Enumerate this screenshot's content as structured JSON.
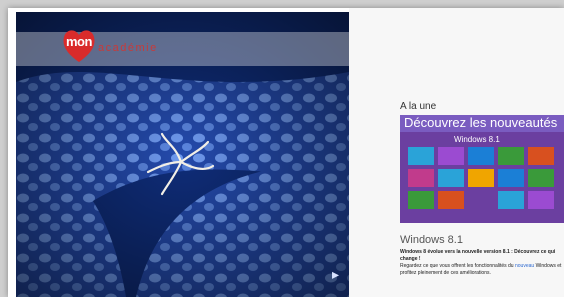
{
  "brand": {
    "name": "mon",
    "suffix": "académie",
    "badge_color": "#d92b2b"
  },
  "hero": {
    "icon": "next-arrow-icon",
    "colors": {
      "background": "#1c3f9e",
      "spots": "#6f9af0",
      "starfish": "#f2efe6"
    }
  },
  "news": {
    "section_title": "A la une",
    "image": {
      "banner_text": "Découvrez les nouveautés",
      "product_label": "Windows 8.1",
      "tile_colors": [
        "#2aa3d8",
        "#9b4bd1",
        "#1b7fd6",
        "#3a9a3a",
        "#d8501f",
        "#c13b8c",
        "#2aa3d8",
        "#f0a500",
        "#1b7fd6",
        "#3a9a3a"
      ]
    },
    "heading": "Windows 8.1",
    "lead": "Windows 8 évolue vers la nouvelle version 8.1 : Découvrez ce qui change !",
    "body_start": "Regardez ce que vous offrent les fonctionnalités du",
    "link": "nouveau",
    "body_end": "Windows et profitez pleinement de ces améliorations."
  }
}
